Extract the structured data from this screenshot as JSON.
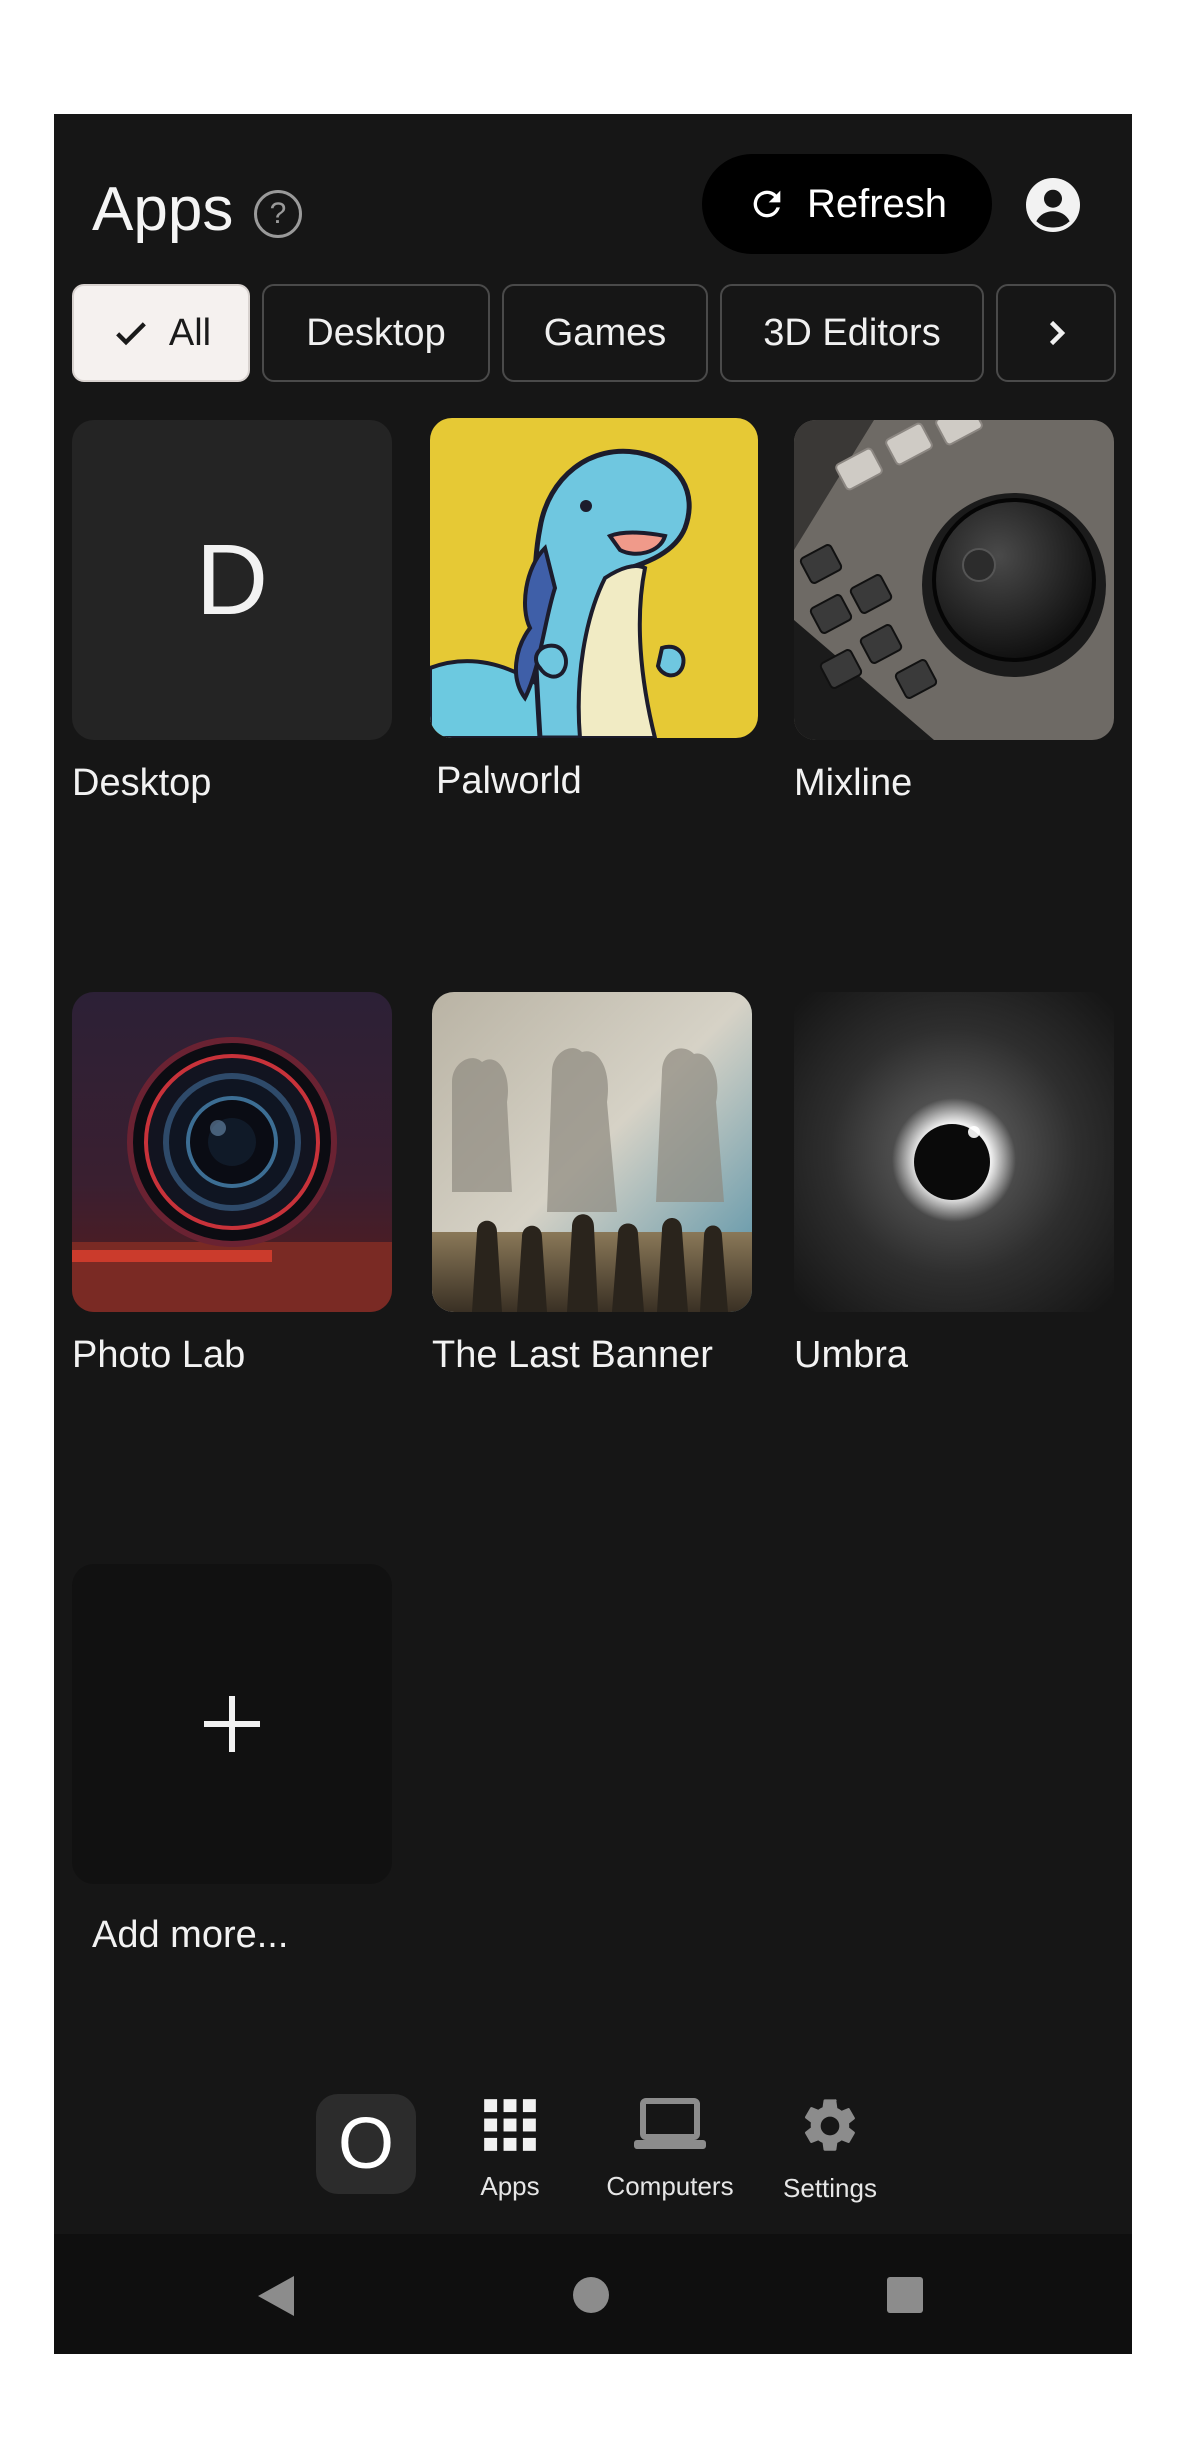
{
  "header": {
    "title": "Apps",
    "help_glyph": "?",
    "refresh_label": "Refresh"
  },
  "filters": {
    "items": [
      {
        "label": "All",
        "selected": true
      },
      {
        "label": "Desktop",
        "selected": false
      },
      {
        "label": "Games",
        "selected": false
      },
      {
        "label": "3D Editors",
        "selected": false
      }
    ]
  },
  "apps": [
    {
      "label": "Desktop",
      "thumb": "letter",
      "letter": "D"
    },
    {
      "label": "Palworld",
      "thumb": "cartoon-creature"
    },
    {
      "label": "Mixline",
      "thumb": "mixing-console"
    },
    {
      "label": "Photo Lab",
      "thumb": "camera-lens"
    },
    {
      "label": "The Last Banner",
      "thumb": "cloaked-figures"
    },
    {
      "label": "Umbra",
      "thumb": "eclipse"
    }
  ],
  "add_more": {
    "label": "Add more..."
  },
  "bottom_nav": {
    "home_glyph": "O",
    "items": [
      {
        "label": "Apps",
        "icon": "grid-icon"
      },
      {
        "label": "Computers",
        "icon": "laptop-icon"
      },
      {
        "label": "Settings",
        "icon": "gear-icon"
      }
    ]
  },
  "colors": {
    "background": "#161616",
    "chip_active": "#f5f1ef",
    "refresh_bg": "#000000"
  }
}
